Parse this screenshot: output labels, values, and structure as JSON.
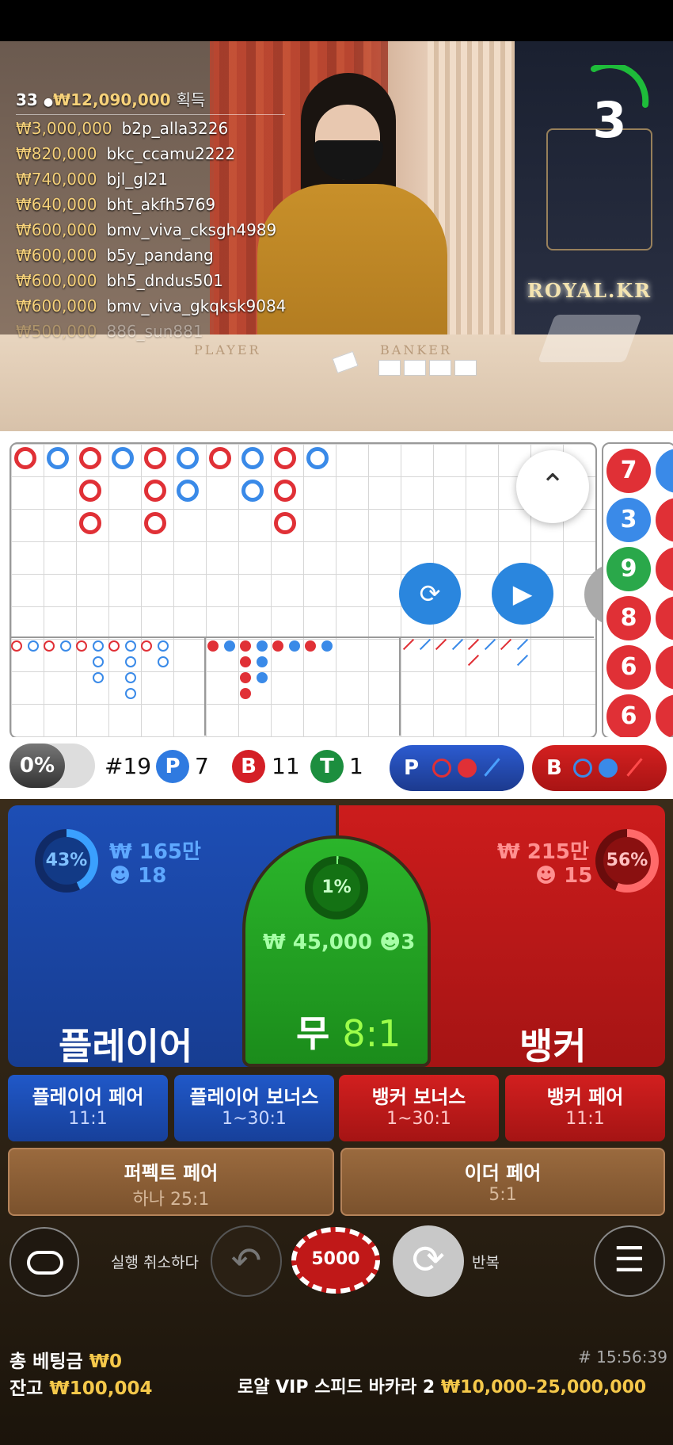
{
  "timer": "3",
  "brand": "ROYAL.KR",
  "video": {
    "player_label": "PLAYER",
    "banker_label": "BANKER"
  },
  "winners": {
    "count": "33",
    "total": "₩12,090,000",
    "label": "획득",
    "list": [
      {
        "amount": "₩3,000,000",
        "user": "b2p_alla3226"
      },
      {
        "amount": "₩820,000",
        "user": "bkc_ccamu2222"
      },
      {
        "amount": "₩740,000",
        "user": "bjl_gl21"
      },
      {
        "amount": "₩640,000",
        "user": "bht_akfh5769"
      },
      {
        "amount": "₩600,000",
        "user": "bmv_viva_cksgh4989"
      },
      {
        "amount": "₩600,000",
        "user": "b5y_pandang"
      },
      {
        "amount": "₩600,000",
        "user": "bh5_dndus501"
      },
      {
        "amount": "₩600,000",
        "user": "bmv_viva_gkqksk9084"
      },
      {
        "amount": "₩500,000",
        "user": "886_sun881"
      }
    ]
  },
  "side_road": [
    "7",
    "3",
    "9",
    "8",
    "6",
    "6"
  ],
  "stats": {
    "percent": "0%",
    "shoe": "#19",
    "player_letter": "P",
    "player_count": "7",
    "banker_letter": "B",
    "banker_count": "11",
    "tie_letter": "T",
    "tie_count": "1",
    "ask_player": "P",
    "ask_banker": "B"
  },
  "bets": {
    "player": {
      "pct": "43%",
      "amount": "₩ 165만",
      "users": "18",
      "name": "플레이어",
      "pct_value": 43
    },
    "tie": {
      "pct": "1%",
      "amount": "₩ 45,000",
      "users": "3",
      "name": "무",
      "odds": "8:1",
      "pct_value": 1
    },
    "banker": {
      "pct": "56%",
      "amount": "₩ 215만",
      "users": "15",
      "name": "뱅커",
      "pct_value": 56
    },
    "side": [
      {
        "title": "플레이어 페어",
        "odds": "11:1"
      },
      {
        "title": "플레이어 보너스",
        "odds": "1~30:1"
      },
      {
        "title": "뱅커 보너스",
        "odds": "1~30:1"
      },
      {
        "title": "뱅커 페어",
        "odds": "11:1"
      }
    ],
    "perfect_pair": {
      "title": "퍼펙트 페어",
      "odds": "하나 25:1"
    },
    "either_pair": {
      "title": "이더 페어",
      "odds": "5:1"
    }
  },
  "controls": {
    "undo_label": "실행 취소하다",
    "chip_value": "5000",
    "repeat_label": "반복"
  },
  "footer": {
    "total_bet_label": "총 베팅금",
    "total_bet_value": "₩0",
    "balance_label": "잔고",
    "balance_value": "₩100,004",
    "round_id": "# 15:56:39",
    "table_name": "로얄 VIP 스피드 바카라 2",
    "limits": "₩10,000–25,000,000"
  },
  "colors": {
    "player": "#1d4eb5",
    "banker": "#cc1c1c",
    "tie": "#2bb52b",
    "gold": "#f5c84a"
  }
}
